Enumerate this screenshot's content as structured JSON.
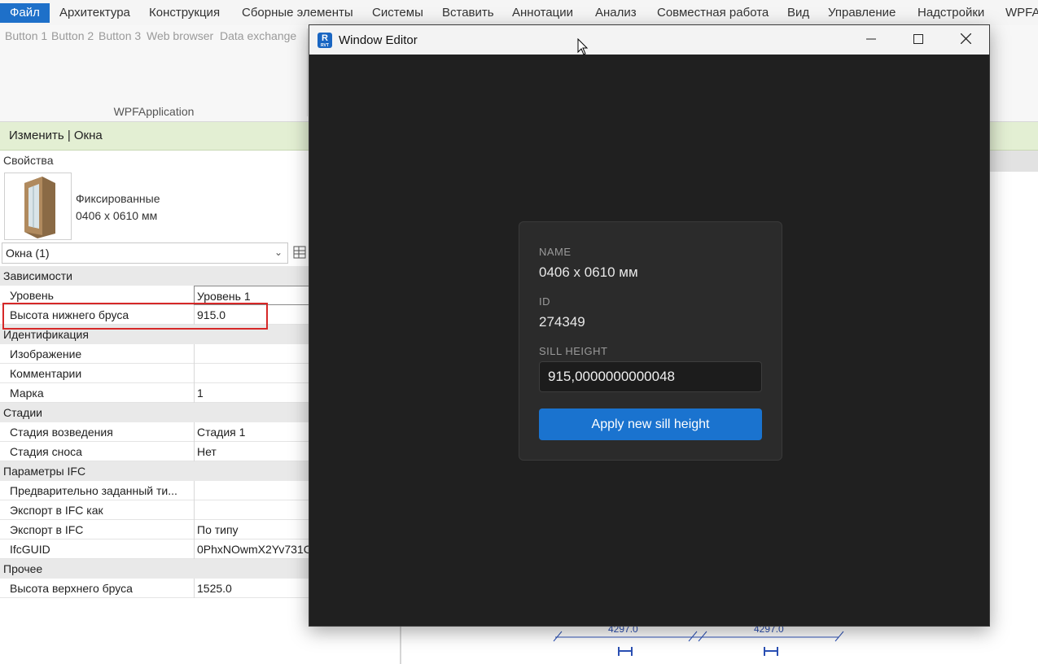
{
  "ribbon": {
    "tabs": [
      "Файл",
      "Архитектура",
      "Конструкция",
      "Сборные элементы",
      "Системы",
      "Вставить",
      "Аннотации",
      "Анализ",
      "Совместная работа",
      "Вид",
      "Управление",
      "Надстройки",
      "WPFA"
    ],
    "buttons": [
      "Button 1",
      "Button 2",
      "Button 3",
      "Web browser",
      "Data exchange"
    ],
    "panel_label": "WPFApplication"
  },
  "context_bar": {
    "label": "Изменить | Окна"
  },
  "properties": {
    "title": "Свойства",
    "type_name_line1": "Фиксированные",
    "type_name_line2": "0406 x 0610 мм",
    "selector_value": "Окна (1)",
    "groups": [
      {
        "name": "Зависимости",
        "rows": [
          {
            "name": "Уровень",
            "value": "Уровень 1"
          },
          {
            "name": "Высота нижнего бруса",
            "value": "915.0"
          }
        ]
      },
      {
        "name": "Идентификация",
        "rows": [
          {
            "name": "Изображение",
            "value": ""
          },
          {
            "name": "Комментарии",
            "value": ""
          },
          {
            "name": "Марка",
            "value": "1"
          }
        ]
      },
      {
        "name": "Стадии",
        "rows": [
          {
            "name": "Стадия возведения",
            "value": "Стадия 1"
          },
          {
            "name": "Стадия сноса",
            "value": "Нет"
          }
        ]
      },
      {
        "name": "Параметры IFC",
        "rows": [
          {
            "name": "Предварительно заданный ти...",
            "value": ""
          },
          {
            "name": "Экспорт в IFC как",
            "value": ""
          },
          {
            "name": "Экспорт в IFC",
            "value": "По типу"
          },
          {
            "name": "IfcGUID",
            "value": "0PhxNOwmX2Yv731C"
          }
        ]
      },
      {
        "name": "Прочее",
        "rows": [
          {
            "name": "Высота верхнего бруса",
            "value": "1525.0"
          }
        ]
      }
    ]
  },
  "drawing": {
    "dim_left": "4297.0",
    "dim_right": "4297.0"
  },
  "modal": {
    "title": "Window Editor",
    "app_icon_letter": "R",
    "app_icon_sub": "RVT",
    "name_label": "NAME",
    "name_value": "0406 x 0610 мм",
    "id_label": "ID",
    "id_value": "274349",
    "sill_label": "SILL HEIGHT",
    "sill_value": "915,0000000000048",
    "apply_label": "Apply new sill height"
  },
  "colors": {
    "accent": "#1e70c9",
    "context_bar": "#e3efd3",
    "highlight": "#d62828",
    "dialog_bg": "#202020",
    "button": "#1a73cf"
  }
}
